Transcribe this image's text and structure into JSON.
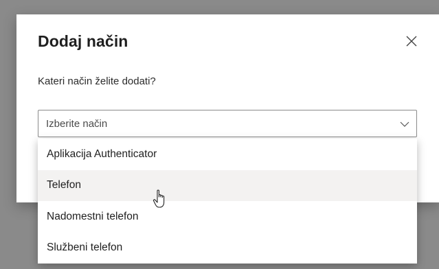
{
  "dialog": {
    "title": "Dodaj način",
    "prompt": "Kateri način želite dodati?",
    "close_icon": "close-icon"
  },
  "select": {
    "value": "Izberite način",
    "icon": "chevron-down-icon"
  },
  "dropdown": {
    "options": [
      {
        "label": "Aplikacija Authenticator",
        "hovered": false
      },
      {
        "label": "Telefon",
        "hovered": true
      },
      {
        "label": "Nadomestni telefon",
        "hovered": false
      },
      {
        "label": "Službeni telefon",
        "hovered": false
      }
    ]
  },
  "cursor": {
    "icon": "hand-pointer-icon"
  },
  "colors": {
    "overlay": "#8a8a8a",
    "hover_background": "#f3f2f1",
    "text": "#1f1f1f"
  }
}
